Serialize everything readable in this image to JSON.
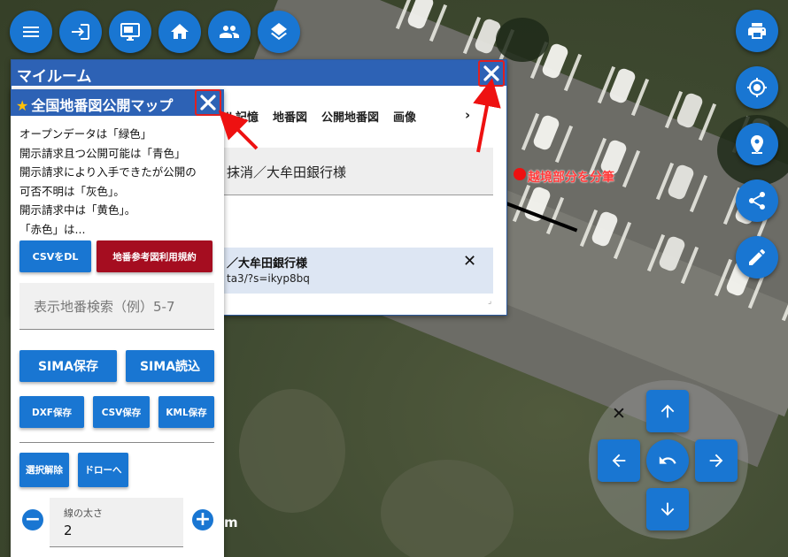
{
  "toolbar": {
    "menu_icon": "menu-icon",
    "login_icon": "login-icon",
    "screen_icon": "screen-icon",
    "home_icon": "home-icon",
    "users_icon": "users-icon",
    "layers_icon": "layers-icon"
  },
  "right_buttons": [
    "print-icon",
    "gps-icon",
    "location-pin-icon",
    "share-icon",
    "edit-pencil-icon"
  ],
  "my_room": {
    "title": "マイルーム",
    "tabs": [
      "ル記憶",
      "地番図",
      "公開地番図",
      "画像"
    ],
    "next_arrow": "›",
    "entry_title": "抹消／大牟田銀行様",
    "item_title": "／大牟田銀行様",
    "item_url": "ta3/?s=ikyp8bq",
    "delete_mark": "✕",
    "accent_color": "#2d62b5"
  },
  "chiban_panel": {
    "title": "全国地番図公開マップ",
    "description": [
      "オープンデータは「緑色」",
      "開示請求且つ公開可能は「青色」",
      "開示請求により入手できたが公開の",
      "可否不明は「灰色」。",
      "開示請求中は「黄色」。",
      "「赤色」は..."
    ],
    "csv_dl": "CSVをDL",
    "terms": "地番参考図利用規約",
    "search_placeholder": "表示地番検索（例）5-7",
    "sima_save": "SIMA保存",
    "sima_load": "SIMA読込",
    "dxf_save": "DXF保存",
    "csv_save": "CSV保存",
    "kml_save": "KML保存",
    "deselect": "選択解除",
    "draw": "ドローへ",
    "minus": "−",
    "plus": "+",
    "line_width_label": "線の太さ",
    "line_width_value": "2"
  },
  "map": {
    "note": "越境部分を分筆",
    "scale_fragment": "m",
    "note_color": "#ff3b3b"
  },
  "dpad": {
    "close": "✕",
    "up": "arrow-up-icon",
    "down": "arrow-down-icon",
    "left": "arrow-left-icon",
    "right": "arrow-right-icon",
    "center": "undo-icon"
  }
}
